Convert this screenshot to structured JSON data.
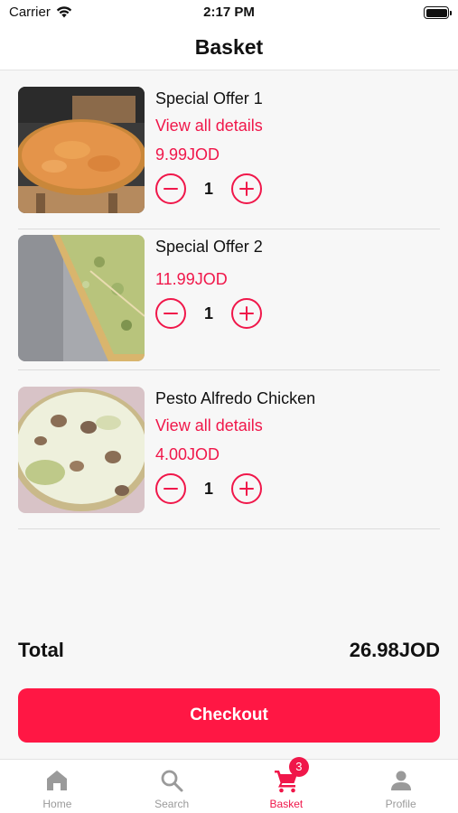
{
  "status_bar": {
    "carrier": "Carrier",
    "time": "2:17 PM"
  },
  "header": {
    "title": "Basket"
  },
  "basket": {
    "items": [
      {
        "name": "Special Offer 1",
        "details_link": "View all details",
        "price": "9.99JOD",
        "quantity": "1",
        "image": "cheese-pizza"
      },
      {
        "name": "Special Offer 2",
        "details_link": "",
        "price": "11.99JOD",
        "quantity": "1",
        "image": "pesto-pizza-slice"
      },
      {
        "name": "Pesto Alfredo Chicken",
        "details_link": "View all details",
        "price": "4.00JOD",
        "quantity": "1",
        "image": "alfredo-mushroom-pizza"
      }
    ]
  },
  "total": {
    "label": "Total",
    "value": "26.98JOD"
  },
  "checkout": {
    "label": "Checkout"
  },
  "tab_bar": {
    "tabs": [
      {
        "label": "Home",
        "icon": "home-icon"
      },
      {
        "label": "Search",
        "icon": "search-icon"
      },
      {
        "label": "Basket",
        "icon": "cart-icon",
        "badge": "3",
        "active": true
      },
      {
        "label": "Profile",
        "icon": "profile-icon"
      }
    ]
  },
  "colors": {
    "accent": "#f0174a",
    "button": "#ff1744",
    "inactive": "#9a9a9a"
  }
}
